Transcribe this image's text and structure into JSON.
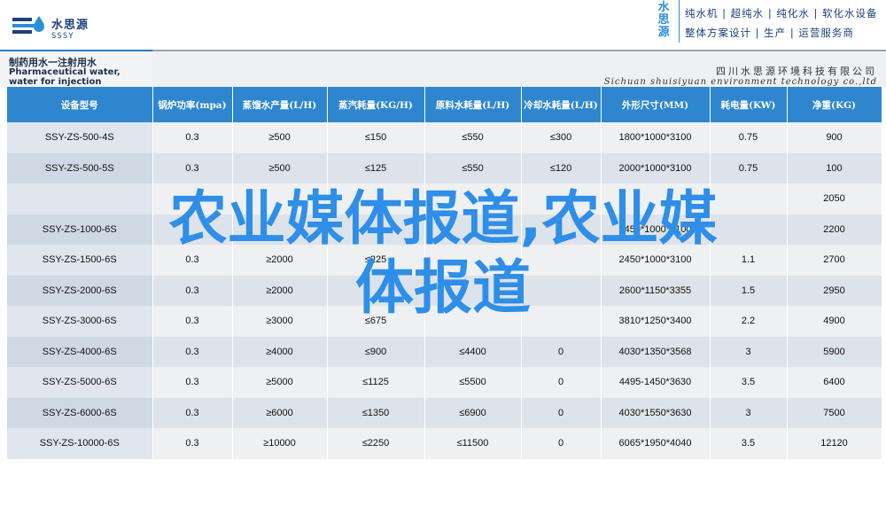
{
  "header": {
    "logo_cn": "水思源",
    "logo_en": "SSSY",
    "vertical_brand": "水思源",
    "slogans": [
      "纯水机 | 超纯水 | 纯化水 | 软化水设备",
      "整体方案设计 | 生产 | 运营服务商"
    ]
  },
  "band": {
    "title_cn": "制药用水一注射用水",
    "title_en": "Pharmaceutical water, water for injection",
    "company_cn": "四川水思源环境科技有限公司",
    "company_en": "Sichuan shuisiyuan environment technology co.,ltd"
  },
  "table": {
    "headers": [
      "设备型号",
      "锅炉功率(mpa)",
      "蒸馏水产量(L/H)",
      "蒸汽耗量(KG/H)",
      "原料水耗量(L/H)",
      "冷却水耗量(L/H)",
      "外形尺寸(MM)",
      "耗电量(KW)",
      "净重(KG)"
    ],
    "rows": [
      [
        "SSY-ZS-500-4S",
        "0.3",
        "≥500",
        "≤150",
        "≤550",
        "≤300",
        "1800*1000*3100",
        "0.75",
        "900"
      ],
      [
        "SSY-ZS-500-5S",
        "0.3",
        "≥500",
        "≤125",
        "≤550",
        "≤120",
        "2000*1000*3100",
        "0.75",
        "100"
      ],
      [
        "",
        "",
        "",
        "",
        "",
        "",
        "",
        "",
        "2050"
      ],
      [
        "SSY-ZS-1000-6S",
        "",
        "",
        "",
        "",
        "",
        "2450*1000*3100",
        "",
        "2200"
      ],
      [
        "SSY-ZS-1500-6S",
        "0.3",
        "≥2000",
        "≤225",
        "",
        "",
        "2450*1000*3100",
        "1.1",
        "2700"
      ],
      [
        "SSY-ZS-2000-6S",
        "0.3",
        "≥2000",
        "",
        "",
        "",
        "2600*1150*3355",
        "1.5",
        "2950"
      ],
      [
        "SSY-ZS-3000-6S",
        "0.3",
        "≥3000",
        "≤675",
        "",
        "",
        "3810*1250*3400",
        "2.2",
        "4900"
      ],
      [
        "SSY-ZS-4000-6S",
        "0.3",
        "≥4000",
        "≤900",
        "≤4400",
        "0",
        "4030*1350*3568",
        "3",
        "5900"
      ],
      [
        "SSY-ZS-5000-6S",
        "0.3",
        "≥5000",
        "≤1125",
        "≤5500",
        "0",
        "4495-1450*3630",
        "3.5",
        "6400"
      ],
      [
        "SSY-ZS-6000-6S",
        "0.3",
        "≥6000",
        "≤1350",
        "≤6900",
        "0",
        "4030*1550*3630",
        "3",
        "7500"
      ],
      [
        "SSY-ZS-10000-6S",
        "0.3",
        "≥10000",
        "≤2250",
        "≤11500",
        "0",
        "6065*1950*4040",
        "3.5",
        "12120"
      ]
    ]
  },
  "overlay": {
    "line1": "农业媒体报道,农业媒",
    "line2": "体报道"
  },
  "colors": {
    "header_blue": "#2e86cf",
    "overlay_blue": "#2e8ee8",
    "row_light": "#eef0f2",
    "row_dark": "#dde3ea"
  }
}
